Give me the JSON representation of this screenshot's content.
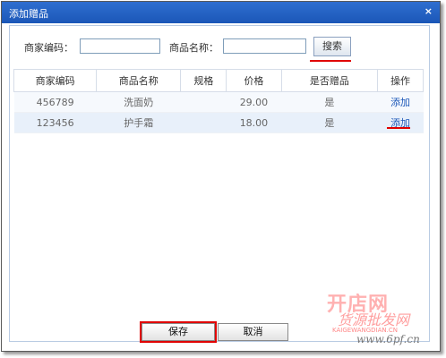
{
  "dialog": {
    "title": "添加赠品",
    "close_label": "×"
  },
  "search": {
    "merchant_code_label": "商家编码：",
    "merchant_code_value": "",
    "product_name_label": "商品名称：",
    "product_name_value": "",
    "search_button": "搜索"
  },
  "table": {
    "headers": [
      "商家编码",
      "商品名称",
      "规格",
      "价格",
      "是否赠品",
      "操作"
    ],
    "rows": [
      {
        "code": "456789",
        "name": "洗面奶",
        "spec": "",
        "price": "29.00",
        "is_gift": "是",
        "action": "添加"
      },
      {
        "code": "123456",
        "name": "护手霜",
        "spec": "",
        "price": "18.00",
        "is_gift": "是",
        "action": "添加"
      }
    ]
  },
  "footer": {
    "save_label": "保存",
    "cancel_label": "取消"
  },
  "watermark": {
    "brand": "开店网",
    "tagline": "货源批发网",
    "domain": "KAIGEWANGDIAN.CN",
    "site": "www.6pf.cn"
  },
  "colors": {
    "title_bar": "#1f5fc4",
    "highlight": "#e00000",
    "link": "#1a56b8"
  }
}
